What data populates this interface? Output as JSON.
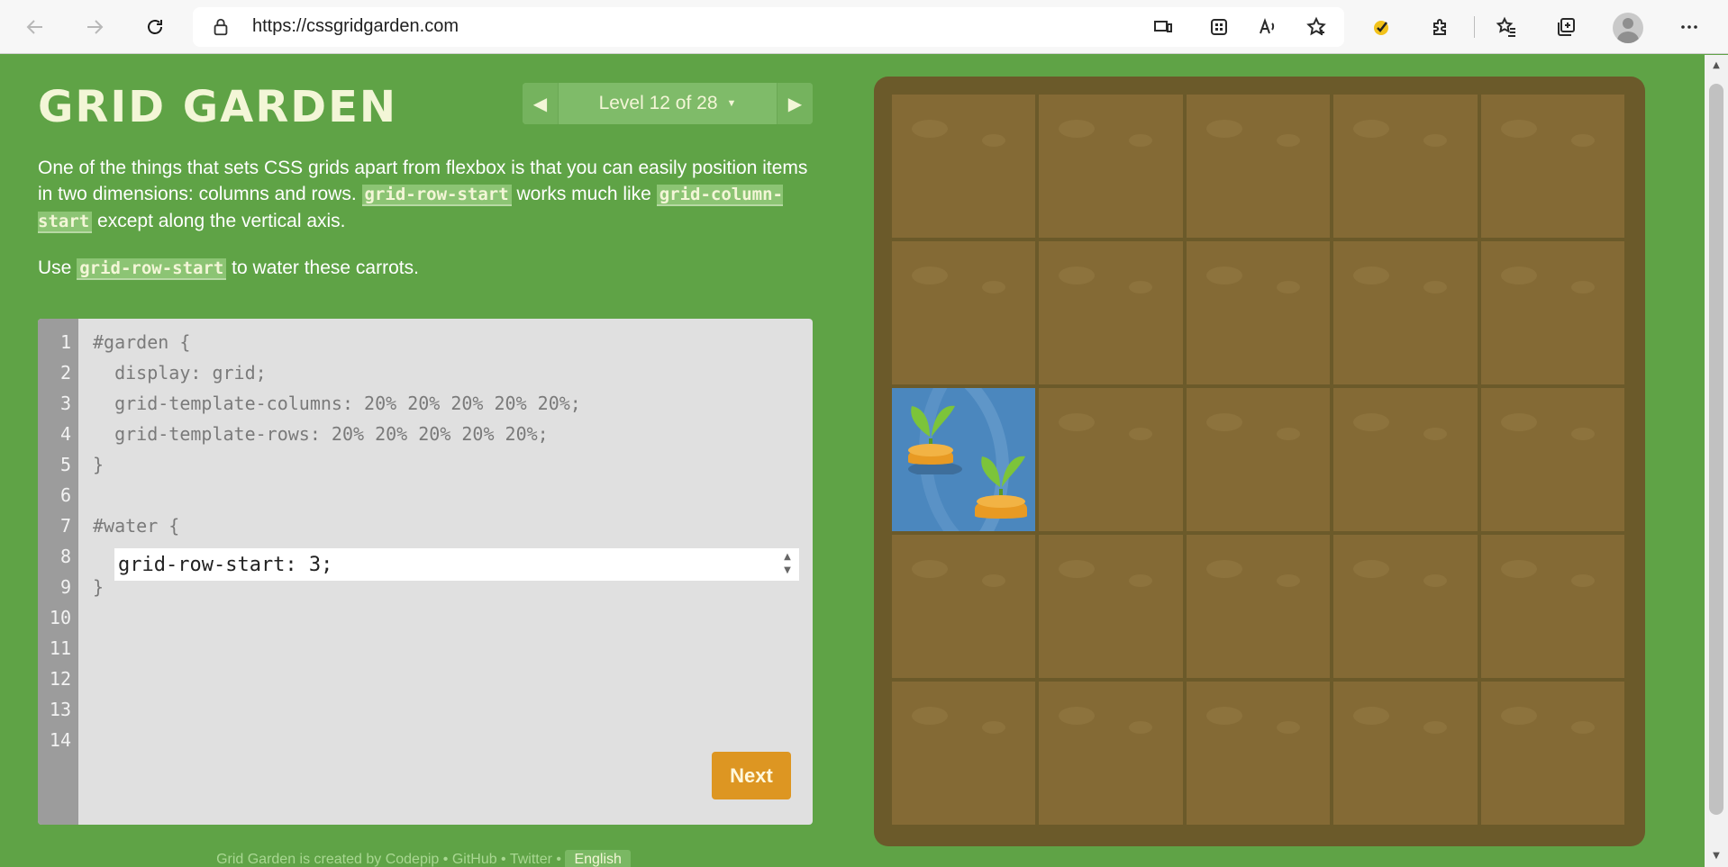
{
  "browser": {
    "url": "https://cssgridgarden.com"
  },
  "page": {
    "title": "GRID GARDEN",
    "level_label": "Level 12 of 28",
    "instructions": {
      "p1_a": "One of the things that sets CSS grids apart from flexbox is that you can easily position items in two dimensions: columns and rows. ",
      "p1_code1": "grid-row-start",
      "p1_b": " works much like ",
      "p1_code2": "grid-column-start",
      "p1_c": " except along the vertical axis.",
      "p2_a": "Use ",
      "p2_code": "grid-row-start",
      "p2_b": " to water these carrots."
    },
    "editor": {
      "line_numbers": [
        "1",
        "2",
        "3",
        "4",
        "5",
        "6",
        "7",
        "8",
        "9",
        "10",
        "11",
        "12",
        "13",
        "14"
      ],
      "lines": {
        "l1": "#garden {",
        "l2": "  display: grid;",
        "l3": "  grid-template-columns: 20% 20% 20% 20% 20%;",
        "l4": "  grid-template-rows: 20% 20% 20% 20% 20%;",
        "l5": "}",
        "l7": "#water {",
        "l9": "}"
      },
      "input_value": "grid-row-start: 3;",
      "next_label": "Next"
    },
    "footer": {
      "text_a": "Grid Garden is created by ",
      "codepip": "Codepip",
      "sep": " • ",
      "github": "GitHub",
      "twitter": "Twitter",
      "language": "English"
    }
  },
  "colors": {
    "page_bg": "#5fa346",
    "soil": "#846a35",
    "water": "#4b87be",
    "carrot": "#e89a23",
    "leaf": "#7cc43a",
    "next_button": "#dd9622"
  }
}
